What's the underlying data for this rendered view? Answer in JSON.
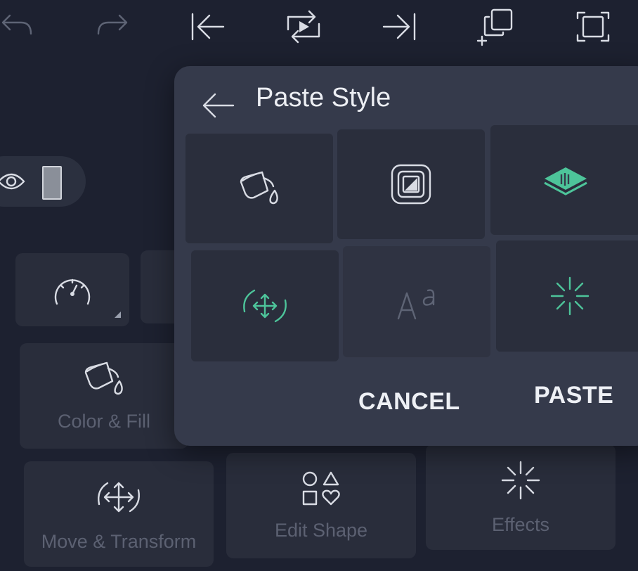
{
  "toolbar": {
    "items": [
      {
        "name": "undo-icon"
      },
      {
        "name": "redo-icon"
      },
      {
        "name": "skip-to-start-icon"
      },
      {
        "name": "preview-loop-icon"
      },
      {
        "name": "skip-to-end-icon"
      },
      {
        "name": "duplicate-icon"
      },
      {
        "name": "fit-screen-icon"
      }
    ]
  },
  "layer": {
    "icons": [
      "visibility-eye-icon",
      "layer-thumbnail"
    ]
  },
  "tools": {
    "items": [
      {
        "icon": "speedometer-icon"
      },
      {
        "icon": "paint-bucket-icon",
        "label": "Color & Fill"
      },
      {
        "icon": "move-transform-icon",
        "label": "Move & Transform"
      },
      {
        "icon": "shapes-icon",
        "label": "Edit Shape"
      },
      {
        "icon": "effects-sparkle-icon",
        "label": "Effects"
      }
    ]
  },
  "dialog": {
    "title": "Paste Style",
    "options": [
      {
        "icon": "paint-bucket-icon",
        "enabled": true
      },
      {
        "icon": "border-frame-icon",
        "enabled": true
      },
      {
        "icon": "layer-blend-icon",
        "enabled": true,
        "selected": true
      },
      {
        "icon": "move-transform-icon",
        "enabled": true,
        "selected": true
      },
      {
        "icon": "text-style-icon",
        "enabled": false
      },
      {
        "icon": "effects-sparkle-icon",
        "enabled": true,
        "selected": true
      }
    ],
    "cancel_label": "CANCEL",
    "paste_label": "PASTE"
  },
  "colors": {
    "background": "#1d2130",
    "dialog": "#353a4b",
    "tile": "#2a2e3c",
    "accent": "#4dc49a",
    "text": "#eceef3",
    "muted": "#5c6172"
  }
}
